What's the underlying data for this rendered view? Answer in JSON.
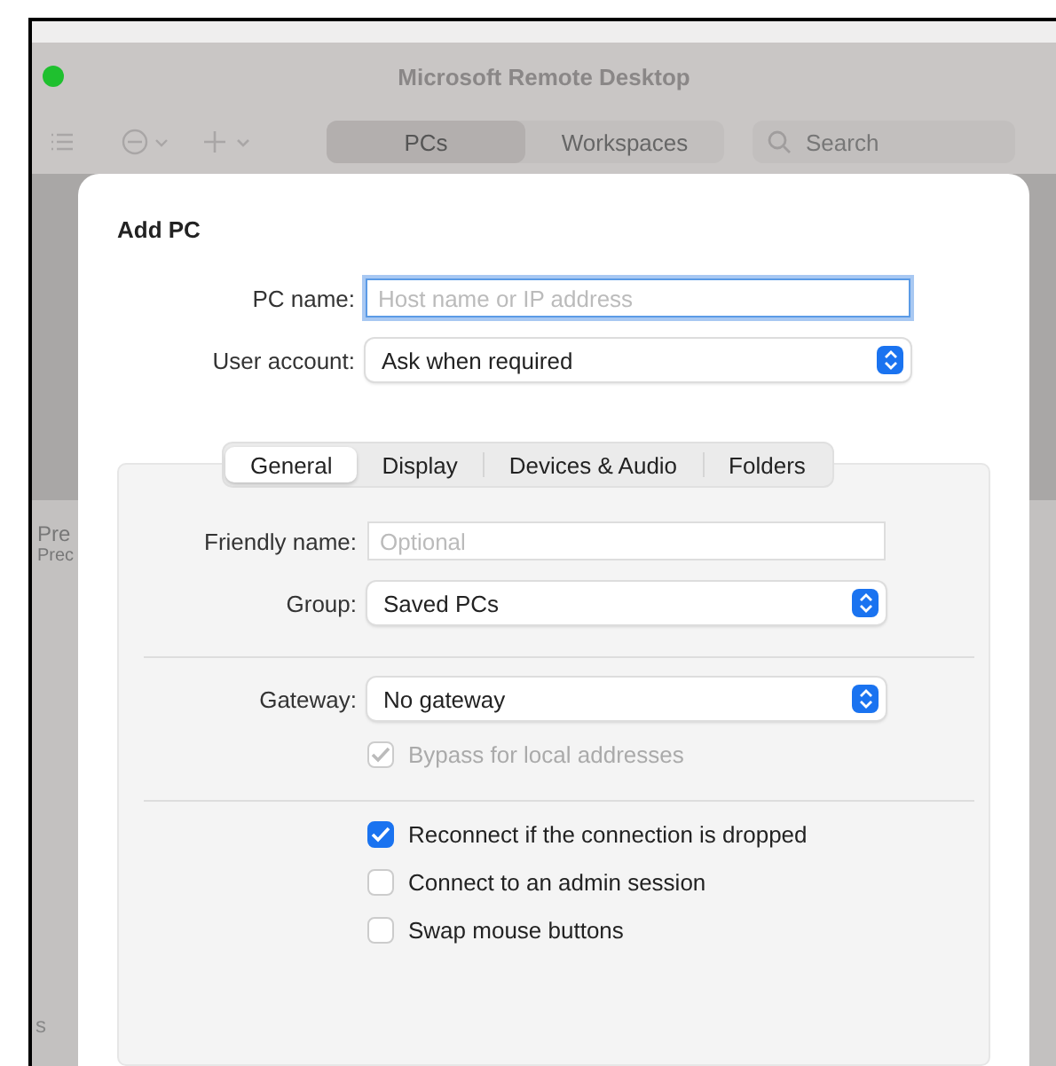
{
  "window": {
    "title": "Microsoft Remote Desktop"
  },
  "toolbar": {
    "views": [
      {
        "label": "PCs",
        "selected": true
      },
      {
        "label": "Workspaces",
        "selected": false
      }
    ],
    "search": {
      "placeholder": "Search"
    }
  },
  "background_items": [
    "Pre",
    "Prec",
    "s"
  ],
  "dialog": {
    "title": "Add PC",
    "fields": [
      {
        "kind": "text",
        "label": "PC name:",
        "placeholder": "Host name or IP address",
        "focused": true
      },
      {
        "kind": "popup",
        "label": "User account:",
        "value": "Ask when required"
      }
    ],
    "tabs": [
      {
        "label": "General",
        "selected": true
      },
      {
        "label": "Display",
        "selected": false
      },
      {
        "label": "Devices & Audio",
        "selected": false
      },
      {
        "label": "Folders",
        "selected": false
      }
    ],
    "sections": [
      {
        "rows": [
          {
            "kind": "text",
            "label": "Friendly name:",
            "placeholder": "Optional"
          },
          {
            "kind": "popup",
            "label": "Group:",
            "value": "Saved PCs"
          }
        ]
      },
      {
        "rows": [
          {
            "kind": "popup",
            "label": "Gateway:",
            "value": "No gateway"
          },
          {
            "kind": "checkbox",
            "label": "Bypass for local addresses",
            "checked": true,
            "disabled": true
          }
        ]
      },
      {
        "rows": [
          {
            "kind": "checkbox",
            "label": "Reconnect if the connection is dropped",
            "checked": true,
            "disabled": false
          },
          {
            "kind": "checkbox",
            "label": "Connect to an admin session",
            "checked": false,
            "disabled": false
          },
          {
            "kind": "checkbox",
            "label": "Swap mouse buttons",
            "checked": false,
            "disabled": false
          }
        ]
      }
    ]
  }
}
